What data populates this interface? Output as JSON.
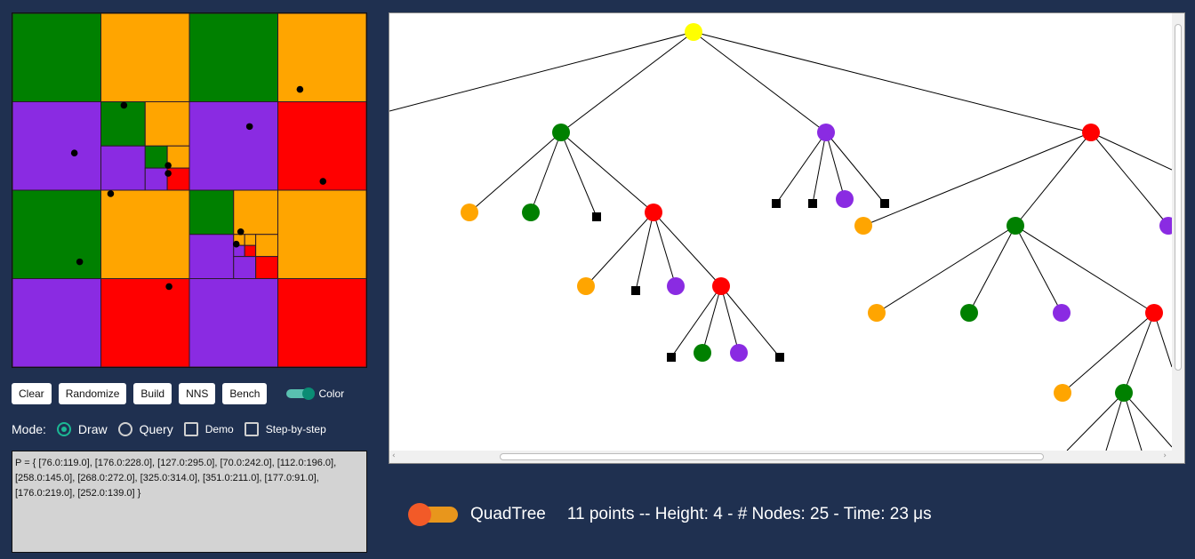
{
  "toolbar": {
    "buttons": [
      "Clear",
      "Randomize",
      "Build",
      "NNS",
      "Bench"
    ],
    "color_toggle_label": "Color",
    "color_toggle_on": true
  },
  "mode": {
    "label": "Mode:",
    "options": [
      "Draw",
      "Query"
    ],
    "selected": "Draw",
    "checkboxes": [
      "Demo",
      "Step-by-step"
    ]
  },
  "points_text": "P = { [76.0:119.0], [176.0:228.0], [127.0:295.0], [70.0:242.0], [112.0:196.0], [258.0:145.0], [268.0:272.0], [325.0:314.0], [351.0:211.0], [177.0:91.0], [176.0:219.0], [252.0:139.0] }",
  "colors": {
    "green": "#008000",
    "orange": "#ffa500",
    "purple": "#8a2be2",
    "red": "#ff0000",
    "root": "#ffff00",
    "background": "#1f3050"
  },
  "status": {
    "structure": "QuadTree",
    "stats": "11 points -- Height: 4 - # Nodes: 25 - Time: 23 μs"
  }
}
